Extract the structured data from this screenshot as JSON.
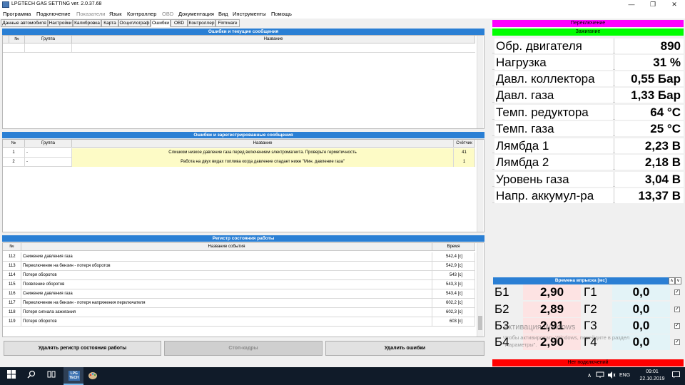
{
  "window": {
    "title": "LPGTECH GAS SETTING ver. 2.0.37.68",
    "minimize": "—",
    "restore": "❐",
    "close": "✕"
  },
  "menu": [
    "Программа",
    "Подключение",
    "Показатели",
    "Язык",
    "Контроллер",
    "OBD",
    "Документация",
    "Вид",
    "Инструменты",
    "Помощь"
  ],
  "tabs": [
    "Данные автомобиля",
    "Настройки",
    "Калибровка",
    "Карта",
    "Осциллограф",
    "Ошибки",
    "OBD",
    "Контроллер",
    "Firmware"
  ],
  "errors_current": {
    "title": "Ошибки и текущие сообщения",
    "columns": [
      "№",
      "Группа",
      "Название"
    ]
  },
  "errors_logged": {
    "title": "Ошибки и зарегестрированные сообщения",
    "columns": [
      "№",
      "Группа",
      "Название",
      "Счётчик"
    ],
    "rows": [
      {
        "n": "1",
        "group": "-",
        "name": "Слишком низкое давление газа перед включением электромагнита. Проверьте герметичность",
        "count": "41"
      },
      {
        "n": "2",
        "group": "-",
        "name": "Работа  на двух видах топлива когда давление спадает ниже \"Мин. давление газа\"",
        "count": "1"
      }
    ]
  },
  "status_register": {
    "title": "Регистр состояния работы",
    "columns": [
      "№",
      "Название  события",
      "Время"
    ],
    "rows": [
      {
        "n": "112",
        "event": "Снижение давления газа",
        "time": "542,4 [c]"
      },
      {
        "n": "113",
        "event": "Переключение на бензин - потеря оборотов",
        "time": "542,9 [c]"
      },
      {
        "n": "114",
        "event": "Потеря оборотов",
        "time": "543 [c]"
      },
      {
        "n": "115",
        "event": "Появление оборотов",
        "time": "543,3 [c]"
      },
      {
        "n": "116",
        "event": "Снижение давления газа",
        "time": "543,4 [c]"
      },
      {
        "n": "117",
        "event": "Переключение на бензин - потеря напряжения перключателя",
        "time": "602,2 [c]"
      },
      {
        "n": "118",
        "event": "Потеря сигнала зажигания",
        "time": "602,3 [c]"
      },
      {
        "n": "119",
        "event": "Потеря оборотов",
        "time": "603 [c]"
      }
    ]
  },
  "buttons": {
    "clear_register": "Удалять регистр состояния работы",
    "freeze_frames": "Стоп-кадры",
    "clear_errors": "Удалить ошибки"
  },
  "status": {
    "switch": "Переключение",
    "ignition": "Зажигание",
    "connection": "Нет подключений",
    "switch_color": "#ff00ff",
    "ignition_color": "#00ff00",
    "connection_color": "#ff0000"
  },
  "parameters": [
    {
      "label": "Обр. двигателя",
      "value": "890"
    },
    {
      "label": "Нагрузка",
      "value": "31 %"
    },
    {
      "label": "Давл. коллектора",
      "value": "0,55 Бар"
    },
    {
      "label": "Давл. газа",
      "value": "1,33 Бар"
    },
    {
      "label": "Темп. редуктора",
      "value": "64 °C"
    },
    {
      "label": "Темп. газа",
      "value": "25 °C"
    },
    {
      "label": "Лямбда 1",
      "value": "2,23 В"
    },
    {
      "label": "Лямбда 2",
      "value": "2,18 В"
    },
    {
      "label": "Уровень газа",
      "value": "3,04 В"
    },
    {
      "label": "Напр. аккумул-ра",
      "value": "13,37 В"
    }
  ],
  "injection": {
    "title": "Времена впрыска [мс]",
    "arrow_up": "∧",
    "arrow_down": "∨",
    "rows": [
      {
        "b": "Б1",
        "bv": "2,90",
        "g": "Г1",
        "gv": "0,0"
      },
      {
        "b": "Б2",
        "bv": "2,89",
        "g": "Г2",
        "gv": "0,0"
      },
      {
        "b": "Б3",
        "bv": "2,91",
        "g": "Г3",
        "gv": "0,0"
      },
      {
        "b": "Б4",
        "bv": "2,90",
        "g": "Г4",
        "gv": "0,0"
      }
    ]
  },
  "watermark": {
    "line1": "Активация Windows",
    "line2": "Чтобы активировать Windows, перейдите в раздел",
    "line3": "\"Параметры\"."
  },
  "taskbar": {
    "lang": "ENG",
    "time": "09:01",
    "date": "22.10.2019",
    "app_label_1": "LPG",
    "app_label_2": "TECH"
  }
}
